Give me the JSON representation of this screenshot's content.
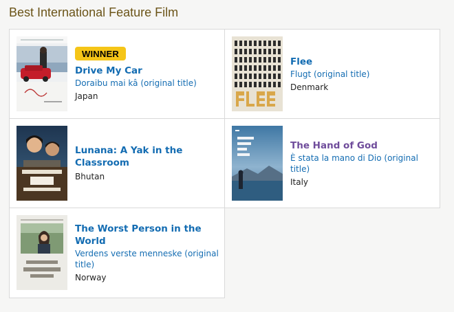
{
  "section": {
    "title": "Best International Feature Film"
  },
  "winner_label": "WINNER",
  "nominees": [
    {
      "title": "Drive My Car",
      "original_title": "Doraibu mai kâ (original title)",
      "country": "Japan",
      "winner": true
    },
    {
      "title": "Flee",
      "original_title": "Flugt (original title)",
      "country": "Denmark",
      "winner": false
    },
    {
      "title": "Lunana: A Yak in the Classroom",
      "original_title": "",
      "country": "Bhutan",
      "winner": false
    },
    {
      "title": "The Hand of God",
      "original_title": "È stata la mano di Dio (original title)",
      "country": "Italy",
      "winner": false
    },
    {
      "title": "The Worst Person in the World",
      "original_title": "Verdens verste menneske (original title)",
      "country": "Norway",
      "winner": false
    }
  ],
  "colors": {
    "section_title": "#6b5418",
    "link": "#136cb2",
    "visited_link": "#6f4c9b",
    "winner_badge": "#f5c518"
  }
}
